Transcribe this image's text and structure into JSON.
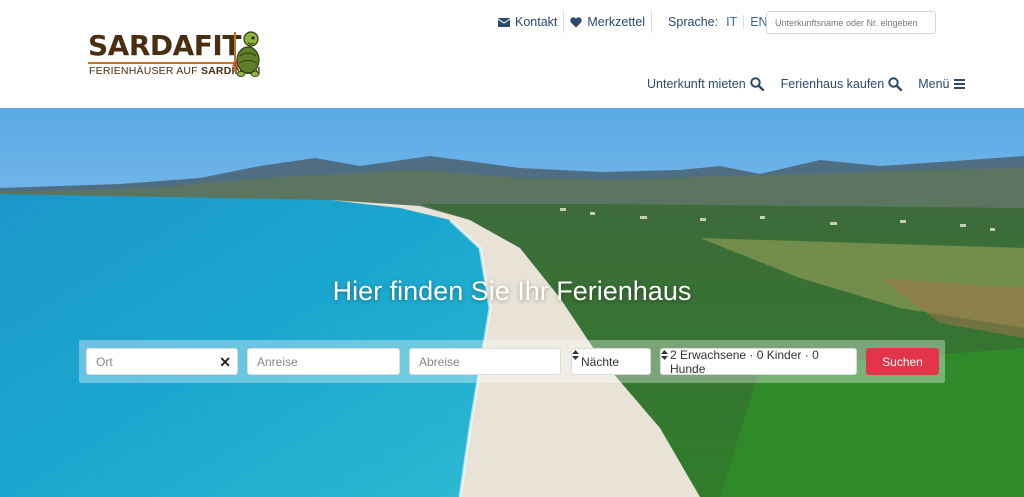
{
  "brand": {
    "name": "SARDAFIT",
    "tagline_prefix": "FERIENHÄUSER AUF",
    "tagline_strong": "SARDINIEN"
  },
  "toplinks": {
    "contact": "Kontakt",
    "wishlist": "Merkzettel",
    "language_label": "Sprache:",
    "lang_it": "IT",
    "lang_en": "EN"
  },
  "site_search": {
    "placeholder": "Unterkunftsname oder Nr. eingeben"
  },
  "nav": {
    "rent": "Unterkunft mieten",
    "buy": "Ferienhaus kaufen",
    "menu": "Menü"
  },
  "hero": {
    "title": "Hier finden Sie Ihr Ferienhaus"
  },
  "search_bar": {
    "location_placeholder": "Ort",
    "arrival_placeholder": "Anreise",
    "departure_placeholder": "Abreise",
    "nights": "Nächte",
    "guests": "2 Erwachsene · 0 Kinder · 0 Hunde",
    "submit": "Suchen"
  },
  "colors": {
    "brand_brown": "#4a2e12",
    "link_blue": "#2c4a6b",
    "submit_red": "#e3344a"
  }
}
